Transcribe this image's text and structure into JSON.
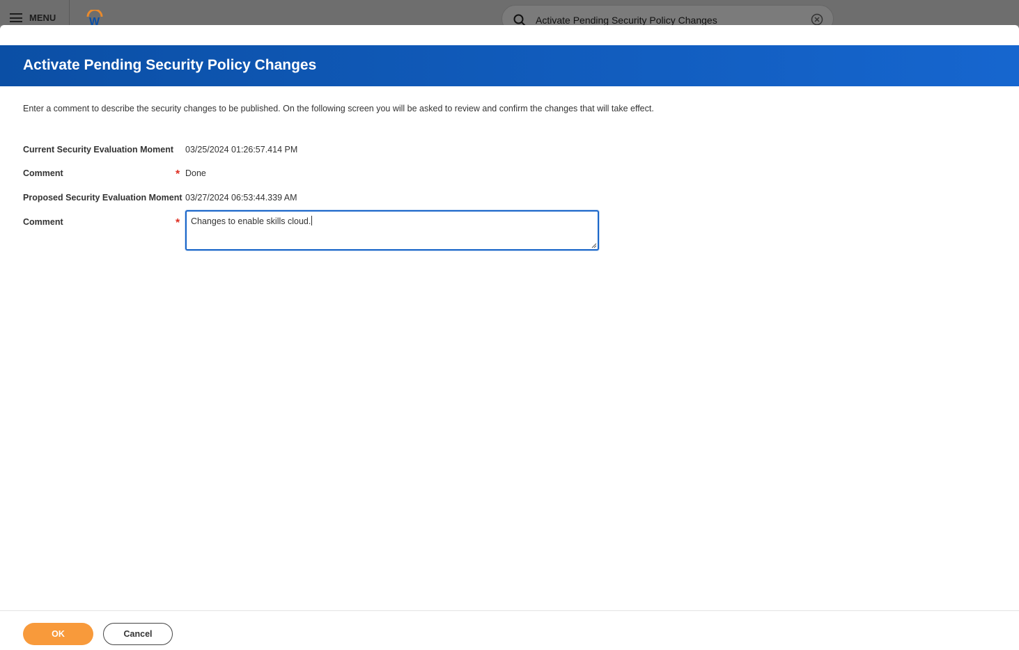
{
  "topbar": {
    "menu_label": "MENU",
    "search_value": "Activate Pending Security Policy Changes"
  },
  "modal": {
    "title": "Activate Pending Security Policy Changes",
    "instructions": "Enter a comment to describe the security changes to be published. On the following screen you will be asked to review and confirm the changes that will take effect.",
    "fields": [
      {
        "label": "Current Security Evaluation Moment",
        "value": "03/25/2024 01:26:57.414 PM",
        "required": false
      },
      {
        "label": "Comment",
        "value": "Done",
        "required": true
      },
      {
        "label": "Proposed Security Evaluation Moment",
        "value": "03/27/2024 06:53:44.339 AM",
        "required": false
      },
      {
        "label": "Comment",
        "value": "Changes to enable skills cloud.",
        "required": true
      }
    ],
    "required_marker": "*"
  },
  "footer": {
    "ok_label": "OK",
    "cancel_label": "Cancel"
  },
  "colors": {
    "header_blue": "#1666cf",
    "ok_orange": "#f89a3b",
    "required_red": "#de2e21"
  }
}
